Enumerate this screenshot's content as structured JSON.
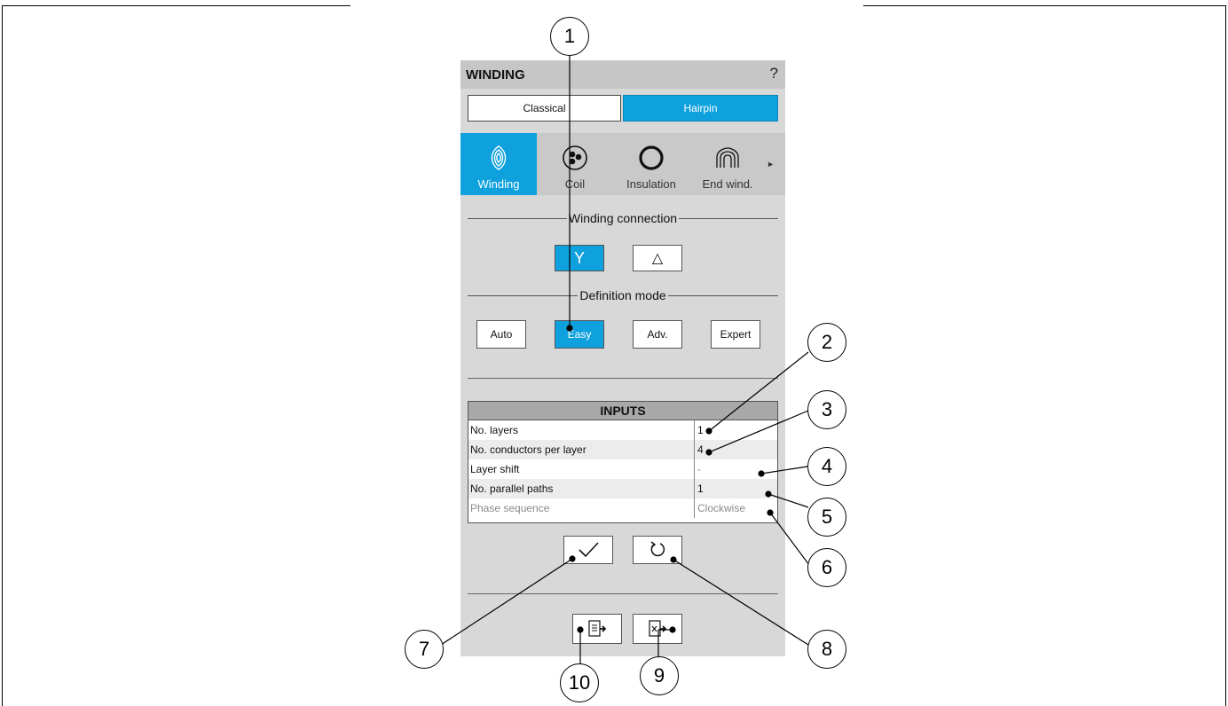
{
  "panel": {
    "title": "WINDING",
    "help": "?",
    "tabs": [
      "Classical",
      "Hairpin"
    ],
    "icon_tabs": [
      {
        "label": "Winding",
        "icon": "winding-icon"
      },
      {
        "label": "Coil",
        "icon": "coil-icon"
      },
      {
        "label": "Insulation",
        "icon": "insulation-icon"
      },
      {
        "label": "End wind.",
        "icon": "end-winding-icon"
      }
    ],
    "more_arrow": "►",
    "winding_connection": {
      "title": "Winding connection",
      "options": [
        "Y",
        "△"
      ],
      "selected": "Y"
    },
    "definition_mode": {
      "title": "Definition mode",
      "options": [
        "Auto",
        "Easy",
        "Adv.",
        "Expert"
      ],
      "selected": "Easy"
    },
    "inputs": {
      "title": "INPUTS",
      "rows": [
        {
          "label": "No. layers",
          "value": "1"
        },
        {
          "label": "No. conductors per layer",
          "value": "4"
        },
        {
          "label": "Layer shift",
          "value": "-"
        },
        {
          "label": "No. parallel paths",
          "value": "1"
        },
        {
          "label": "Phase sequence",
          "value": "Clockwise"
        }
      ]
    },
    "actions": {
      "apply": "✓",
      "reset": "↻"
    },
    "files": {
      "import": "import-icon",
      "export": "export-excel-icon"
    }
  },
  "callouts": [
    "1",
    "2",
    "3",
    "4",
    "5",
    "6",
    "7",
    "8",
    "9",
    "10"
  ],
  "colors": {
    "accent": "#0ea1dd",
    "panel_bg": "#d8d8d8"
  }
}
